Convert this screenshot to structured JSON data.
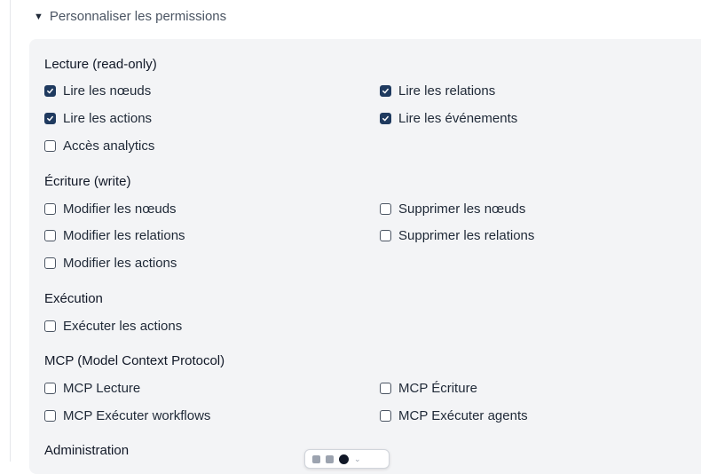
{
  "summary": {
    "label": "Personnaliser les permissions",
    "icon": "triangle-down-icon"
  },
  "groups": {
    "lecture": {
      "title": "Lecture (read-only)",
      "items": [
        {
          "label": "Lire les nœuds",
          "checked": true
        },
        {
          "label": "Lire les relations",
          "checked": true
        },
        {
          "label": "Lire les actions",
          "checked": true
        },
        {
          "label": "Lire les événements",
          "checked": true
        },
        {
          "label": "Accès analytics",
          "checked": false
        }
      ]
    },
    "ecriture": {
      "title": "Écriture (write)",
      "items": [
        {
          "label": "Modifier les nœuds",
          "checked": false
        },
        {
          "label": "Supprimer les nœuds",
          "checked": false
        },
        {
          "label": "Modifier les relations",
          "checked": false
        },
        {
          "label": "Supprimer les relations",
          "checked": false
        },
        {
          "label": "Modifier les actions",
          "checked": false
        }
      ]
    },
    "execution": {
      "title": "Exécution",
      "items": [
        {
          "label": "Exécuter les actions",
          "checked": false
        }
      ]
    },
    "mcp": {
      "title": "MCP (Model Context Protocol)",
      "items": [
        {
          "label": "MCP Lecture",
          "checked": false
        },
        {
          "label": "MCP Écriture",
          "checked": false
        },
        {
          "label": "MCP Exécuter workflows",
          "checked": false
        },
        {
          "label": "MCP Exécuter agents",
          "checked": false
        }
      ]
    },
    "administration": {
      "title": "Administration"
    }
  },
  "colors": {
    "checkbox_checked": "#1f3a5f",
    "panel_bg": "#f3f4f6"
  }
}
